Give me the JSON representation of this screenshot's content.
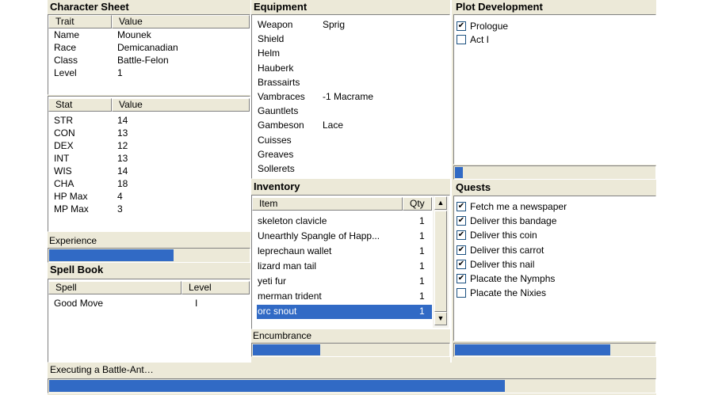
{
  "character_sheet": {
    "title": "Character Sheet",
    "trait_header": {
      "col1": "Trait",
      "col2": "Value"
    },
    "traits": [
      {
        "name": "Name",
        "value": "Mounek"
      },
      {
        "name": "Race",
        "value": "Demicanadian"
      },
      {
        "name": "Class",
        "value": "Battle-Felon"
      },
      {
        "name": "Level",
        "value": "1"
      }
    ],
    "stat_header": {
      "col1": "Stat",
      "col2": "Value"
    },
    "stats": [
      {
        "name": "STR",
        "value": "14"
      },
      {
        "name": "CON",
        "value": "13"
      },
      {
        "name": "DEX",
        "value": "12"
      },
      {
        "name": "INT",
        "value": "13"
      },
      {
        "name": "WIS",
        "value": "14"
      },
      {
        "name": "CHA",
        "value": "18"
      },
      {
        "name": "HP Max",
        "value": "4"
      },
      {
        "name": "MP Max",
        "value": "3"
      }
    ],
    "experience_label": "Experience",
    "experience_progress": 0.62
  },
  "spell_book": {
    "title": "Spell Book",
    "header": {
      "col1": "Spell",
      "col2": "Level"
    },
    "spells": [
      {
        "name": "Good Move",
        "level": "I"
      }
    ]
  },
  "equipment": {
    "title": "Equipment",
    "items": [
      {
        "slot": "Weapon",
        "item": "Sprig"
      },
      {
        "slot": "Shield",
        "item": ""
      },
      {
        "slot": "Helm",
        "item": ""
      },
      {
        "slot": "Hauberk",
        "item": ""
      },
      {
        "slot": "Brassairts",
        "item": ""
      },
      {
        "slot": "Vambraces",
        "item": "-1 Macrame"
      },
      {
        "slot": "Gauntlets",
        "item": ""
      },
      {
        "slot": "Gambeson",
        "item": "Lace"
      },
      {
        "slot": "Cuisses",
        "item": ""
      },
      {
        "slot": "Greaves",
        "item": ""
      },
      {
        "slot": "Sollerets",
        "item": ""
      }
    ]
  },
  "inventory": {
    "title": "Inventory",
    "header": {
      "col1": "Item",
      "col2": "Qty"
    },
    "items": [
      {
        "name": "skeleton clavicle",
        "qty": "1"
      },
      {
        "name": "Unearthly Spangle of Happ...",
        "qty": "1"
      },
      {
        "name": "leprechaun wallet",
        "qty": "1"
      },
      {
        "name": "lizard man tail",
        "qty": "1"
      },
      {
        "name": "yeti fur",
        "qty": "1"
      },
      {
        "name": "merman trident",
        "qty": "1"
      },
      {
        "name": "orc snout",
        "qty": "1"
      }
    ],
    "encumbrance_label": "Encumbrance",
    "encumbrance_progress": 0.34
  },
  "plot": {
    "title": "Plot Development",
    "acts": [
      {
        "label": "Prologue",
        "checked": true
      },
      {
        "label": "Act I",
        "checked": false
      }
    ],
    "progress": 0.04
  },
  "quests": {
    "title": "Quests",
    "items": [
      {
        "label": "Fetch me a newspaper",
        "checked": true
      },
      {
        "label": "Deliver this bandage",
        "checked": true
      },
      {
        "label": "Deliver this coin",
        "checked": true
      },
      {
        "label": "Deliver this carrot",
        "checked": true
      },
      {
        "label": "Deliver this nail",
        "checked": true
      },
      {
        "label": "Placate the Nymphs",
        "checked": true
      },
      {
        "label": "Placate the Nixies",
        "checked": false
      }
    ],
    "progress": 0.77
  },
  "status": {
    "text": "Executing a Battle-Ant…",
    "progress": 0.75
  },
  "colors": {
    "accent": "#316ac5",
    "panel": "#ece9d8"
  }
}
